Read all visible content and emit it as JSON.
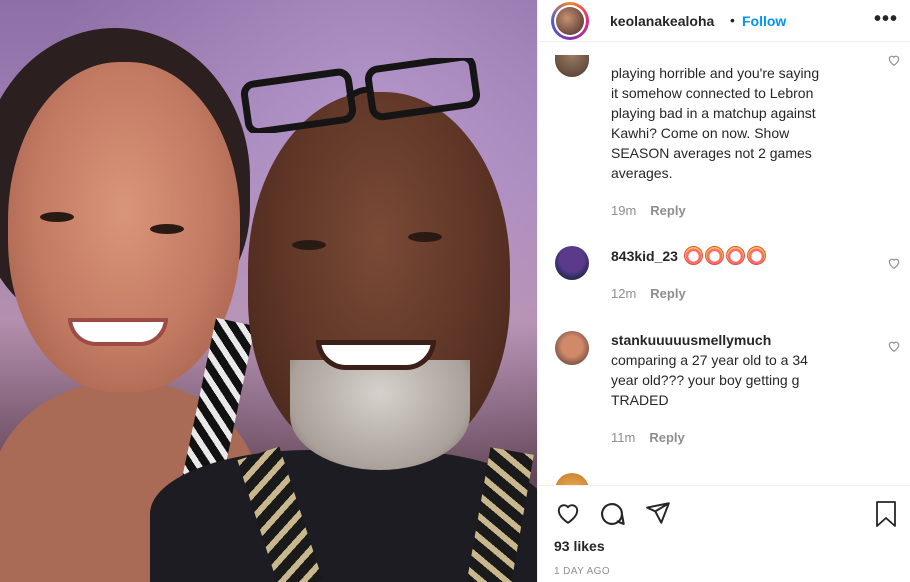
{
  "header": {
    "username": "keolanakealoha",
    "separator": "•",
    "follow_label": "Follow",
    "more_label": "•••"
  },
  "comments": [
    {
      "user": "",
      "text_lines": [
        "playing horrible and you're saying",
        "it somehow connected to Lebron",
        "playing bad in a matchup against",
        "Kawhi? Come on now. Show",
        "SEASON averages not 2 games",
        "averages."
      ],
      "time": "19m",
      "reply_label": "Reply"
    },
    {
      "user": "843kid_23",
      "emoji_count": 4,
      "emoji_name": "clown-face-icon",
      "time": "12m",
      "reply_label": "Reply"
    },
    {
      "user": "stankuuuuusmellymuch",
      "text_lines": [
        "comparing a 27 year old to a 34",
        "year old??? your boy getting g",
        "TRADED"
      ],
      "time": "11m",
      "reply_label": "Reply"
    }
  ],
  "actions": {
    "likes": "93 likes",
    "time_ago": "1 DAY AGO"
  },
  "colors": {
    "follow": "#0095f6",
    "meta": "#8e8e8e",
    "text": "#262626"
  }
}
